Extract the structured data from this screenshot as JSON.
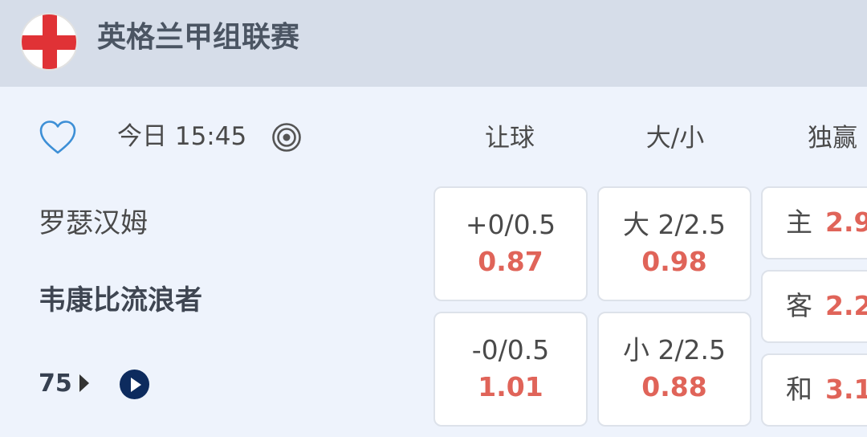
{
  "header": {
    "league_name": "英格兰甲组联赛",
    "flag_icon": "england-flag-icon",
    "flag_colors": {
      "cross": "#e03236",
      "field": "#ffffff"
    }
  },
  "match": {
    "time": "今日 15:45",
    "home_team": "罗瑟汉姆",
    "away_team": "韦康比流浪者",
    "minute": "75",
    "icons": [
      "heart-icon",
      "target-icon",
      "play-icon"
    ]
  },
  "columns": {
    "handicap": "让球",
    "over_under": "大/小",
    "win": "独赢"
  },
  "handicap": [
    {
      "line": "+0/0.5",
      "odds": "0.87"
    },
    {
      "line": "-0/0.5",
      "odds": "1.01"
    }
  ],
  "over_under": [
    {
      "line": "大 2/2.5",
      "odds": "0.98"
    },
    {
      "line": "小 2/2.5",
      "odds": "0.88"
    }
  ],
  "win": [
    {
      "label": "主",
      "odds": "2.9"
    },
    {
      "label": "客",
      "odds": "2.2"
    },
    {
      "label": "和",
      "odds": "3.1"
    }
  ],
  "colors": {
    "odds": "#e06459",
    "header_bg": "#d6dde9",
    "page_bg": "#eef3fc",
    "heart": "#3d8fd6",
    "play_bg": "#0d2b5e"
  }
}
